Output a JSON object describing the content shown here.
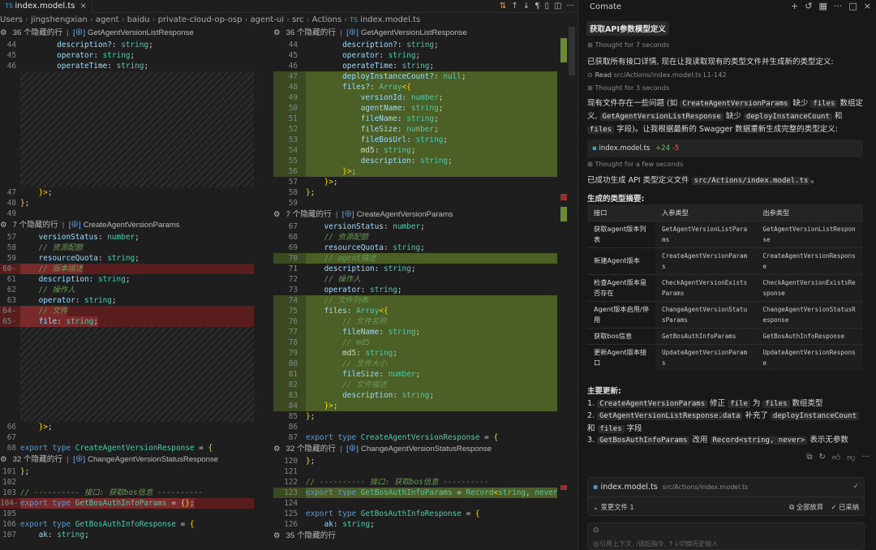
{
  "tab": {
    "title": "index.model.ts",
    "close": "×"
  },
  "toolbar": {
    "icons": [
      "compare-changes-icon",
      "arrow-up-icon",
      "arrow-down-icon",
      "pilcrow-icon",
      "inline-diff-icon",
      "split-editor-icon",
      "more-icon"
    ]
  },
  "breadcrumb": [
    "Users",
    "jingshengxian",
    "agent",
    "baidu",
    "private-cloud-op-osp",
    "agent-ui",
    "src",
    "Actions",
    "index.model.ts"
  ],
  "left_lines": [
    {
      "t": "fold",
      "text": "36 个隐藏的行",
      "sep": "|",
      "sym": "GetAgentVersionListResponse"
    },
    {
      "n": "44",
      "c": "        description?: string;"
    },
    {
      "n": "45",
      "c": "        operator: string;"
    },
    {
      "n": "46",
      "c": "        operateTime: string;"
    },
    {
      "t": "hatch",
      "h": 11
    },
    {
      "n": "47",
      "c": "    }>;"
    },
    {
      "n": "48",
      "c": "};"
    },
    {
      "n": "49",
      "c": ""
    },
    {
      "t": "fold",
      "text": "7 个隐藏的行",
      "sep": "|",
      "sym": "CreateAgentVersionParams"
    },
    {
      "n": "57",
      "c": "    versionStatus: number;"
    },
    {
      "n": "58",
      "c": "    // 资源配额",
      "k": "cm"
    },
    {
      "n": "59",
      "c": "    resourceQuota: string;"
    },
    {
      "n": "60",
      "c": "    // 版本描述",
      "k": "cm",
      "d": "del"
    },
    {
      "n": "61",
      "c": "    description: string;"
    },
    {
      "n": "62",
      "c": "    // 操作人",
      "k": "cm"
    },
    {
      "n": "63",
      "c": "    operator: string;"
    },
    {
      "n": "64",
      "c": "    // 文件",
      "k": "cm",
      "d": "del"
    },
    {
      "n": "65",
      "c": "    file: string;",
      "d": "del"
    },
    {
      "t": "hatch",
      "h": 9
    },
    {
      "n": "66",
      "c": "    }>;"
    },
    {
      "n": "67",
      "c": ""
    },
    {
      "n": "68",
      "c": "export type CreateAgentVersionResponse = {"
    },
    {
      "t": "fold",
      "text": "32 个隐藏的行",
      "sep": "|",
      "sym": "ChangeAgentVersionStatusResponse"
    },
    {
      "n": "101",
      "c": "};"
    },
    {
      "n": "102",
      "c": ""
    },
    {
      "n": "103",
      "c": "// ---------- 接口: 获取bos信息 ----------",
      "k": "cm"
    },
    {
      "n": "104",
      "c": "export type GetBosAuthInfoParams = {};",
      "d": "del"
    },
    {
      "n": "105",
      "c": ""
    },
    {
      "n": "106",
      "c": "export type GetBosAuthInfoResponse = {"
    },
    {
      "n": "107",
      "c": "    ak: string;"
    },
    {
      "t": "fold",
      "text": "35 个隐藏的行",
      "sep": "",
      "sym": ""
    }
  ],
  "right_lines": [
    {
      "t": "fold",
      "text": "36 个隐藏的行",
      "sep": "|",
      "sym": "GetAgentVersionListResponse"
    },
    {
      "n": "44",
      "c": "        description?: string;"
    },
    {
      "n": "45",
      "c": "        operator: string;"
    },
    {
      "n": "46",
      "c": "        operateTime: string;"
    },
    {
      "n": "47",
      "c": "        deployInstanceCount?: null;",
      "d": "add"
    },
    {
      "n": "48",
      "c": "        files?: Array<{",
      "d": "add"
    },
    {
      "n": "49",
      "c": "            versionId: number;",
      "d": "add"
    },
    {
      "n": "50",
      "c": "            agentName: string;",
      "d": "add"
    },
    {
      "n": "51",
      "c": "            fileName: string;",
      "d": "add"
    },
    {
      "n": "52",
      "c": "            fileSize: number;",
      "d": "add"
    },
    {
      "n": "53",
      "c": "            fileBosUrl: string;",
      "d": "add"
    },
    {
      "n": "54",
      "c": "            md5: string;",
      "d": "add"
    },
    {
      "n": "55",
      "c": "            description: string;",
      "d": "add"
    },
    {
      "n": "56",
      "c": "        }>;",
      "d": "add"
    },
    {
      "n": "57",
      "c": "    }>;"
    },
    {
      "n": "58",
      "c": "};"
    },
    {
      "n": "59",
      "c": ""
    },
    {
      "t": "fold",
      "text": "7 个隐藏的行",
      "sep": "|",
      "sym": "CreateAgentVersionParams"
    },
    {
      "n": "67",
      "c": "    versionStatus: number;"
    },
    {
      "n": "68",
      "c": "    // 资源配额",
      "k": "cm"
    },
    {
      "n": "69",
      "c": "    resourceQuota: string;"
    },
    {
      "n": "70",
      "c": "    // agent描述",
      "k": "cm",
      "d": "add"
    },
    {
      "n": "71",
      "c": "    description: string;"
    },
    {
      "n": "72",
      "c": "    // 操作人",
      "k": "cm"
    },
    {
      "n": "73",
      "c": "    operator: string;"
    },
    {
      "n": "74",
      "c": "    // 文件列表",
      "k": "cm",
      "d": "add"
    },
    {
      "n": "75",
      "c": "    files: Array<{",
      "d": "add"
    },
    {
      "n": "76",
      "c": "        // 文件名称",
      "k": "cm",
      "d": "add"
    },
    {
      "n": "77",
      "c": "        fileName: string;",
      "d": "add"
    },
    {
      "n": "78",
      "c": "        // md5",
      "k": "cm",
      "d": "add"
    },
    {
      "n": "79",
      "c": "        md5: string;",
      "d": "add"
    },
    {
      "n": "80",
      "c": "        // 文件大小",
      "k": "cm",
      "d": "add"
    },
    {
      "n": "81",
      "c": "        fileSize: number;",
      "d": "add"
    },
    {
      "n": "82",
      "c": "        // 文件描述",
      "k": "cm",
      "d": "add"
    },
    {
      "n": "83",
      "c": "        description: string;",
      "d": "add"
    },
    {
      "n": "84",
      "c": "    }>;",
      "d": "add"
    },
    {
      "n": "85",
      "c": "};"
    },
    {
      "n": "86",
      "c": ""
    },
    {
      "n": "87",
      "c": "export type CreateAgentVersionResponse = {"
    },
    {
      "t": "fold",
      "text": "32 个隐藏的行",
      "sep": "|",
      "sym": "ChangeAgentVersionStatusResponse"
    },
    {
      "n": "120",
      "c": "};"
    },
    {
      "n": "121",
      "c": ""
    },
    {
      "n": "122",
      "c": "// ---------- 接口: 获取bos信息 ----------",
      "k": "cm"
    },
    {
      "n": "123",
      "c": "export type GetBosAuthInfoParams = Record<string, never>;",
      "d": "add"
    },
    {
      "n": "124",
      "c": ""
    },
    {
      "n": "125",
      "c": "export type GetBosAuthInfoResponse = {"
    },
    {
      "n": "126",
      "c": "    ak: string;"
    },
    {
      "t": "fold",
      "text": "35 个隐藏的行",
      "sep": "",
      "sym": ""
    }
  ],
  "panel": {
    "title": "Comate",
    "action_icons": [
      "plus-icon",
      "history-icon",
      "settings-icon",
      "more-icon",
      "maximize-icon",
      "close-icon"
    ],
    "task_chip": "获取API参数模型定义",
    "thought1": "Thought for 7 seconds",
    "msg1": "已获取所有接口详情, 现在让我读取现有的类型文件并生成新的类型定义:",
    "read_label": "Read",
    "read_path": "src/Actions/index.model.ts L1-142",
    "thought2": "Thought for 3 seconds",
    "msg2_parts": [
      "现有文件存在一些问题 (如 ",
      "CreateAgentVersionParams",
      " 缺少 ",
      "files",
      " 数组定义, ",
      "GetAgentVersionListResponse",
      " 缺少 ",
      "deployInstanceCount",
      " 和 ",
      "files",
      " 字段)。让我根据最新的 Swagger 数据重新生成完整的类型定义:"
    ],
    "file_card": {
      "name": "index.model.ts",
      "added": "+24",
      "removed": "-5"
    },
    "thought3": "Thought for a few seconds",
    "msg3_pre": "已成功生成 API 类型定义文件 ",
    "msg3_code": "src/Actions/index.model.ts",
    "msg3_post": "。",
    "summary_title": "生成的类型摘要:",
    "table": {
      "headers": [
        "接口",
        "入参类型",
        "出参类型"
      ],
      "rows": [
        [
          "获取agent版本列表",
          "GetAgentVersionListParams",
          "GetAgentVersionListResponse"
        ],
        [
          "新建Agent版本",
          "CreateAgentVersionParams",
          "CreateAgentVersionResponse"
        ],
        [
          "检查Agent版本是否存在",
          "CheckAgentVersionExistsParams",
          "CheckAgentVersionExistsResponse"
        ],
        [
          "Agent版本启用/停用",
          "ChangeAgentVersionStatusParams",
          "ChangeAgentVersionStatusResponse"
        ],
        [
          "获取bos信息",
          "GetBosAuthInfoParams",
          "GetBosAuthInfoResponse"
        ],
        [
          "更新Agent版本接口",
          "UpdateAgentVersionParams",
          "UpdateAgentVersionResponse"
        ]
      ]
    },
    "updates_title": "主要更新:",
    "updates": [
      {
        "num": "1.",
        "parts": [
          "CreateAgentVersionParams",
          " 修正 ",
          "file",
          " 为 ",
          "files",
          " 数组类型"
        ]
      },
      {
        "num": "2.",
        "parts": [
          "GetAgentVersionListResponse.data",
          " 补充了 ",
          "deployInstanceCount",
          " 和 ",
          "files",
          " 字段"
        ]
      },
      {
        "num": "3.",
        "parts": [
          "GetBosAuthInfoParams",
          " 改用 ",
          "Record<string, never>",
          " 表示无参数"
        ]
      }
    ],
    "bottom": {
      "file_name": "index.model.ts",
      "file_path": "src/Actions/index.model.ts",
      "changed": "变更文件 1",
      "discard_all": "全部放弃",
      "accepted": "已采纳"
    },
    "input_placeholder": "@引用上下文, /调起指令, ↑↓切换历史输入"
  }
}
